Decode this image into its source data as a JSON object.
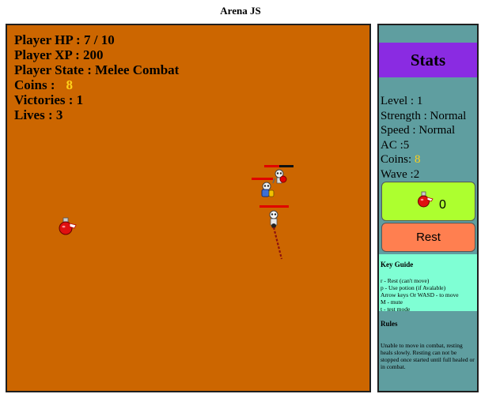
{
  "title": "Arena JS",
  "hud": {
    "hp": "Player HP : 7 / 10",
    "xp": "Player XP : 200",
    "state": "Player State : Melee Combat",
    "coins_label": "Coins :",
    "coins_value": "8",
    "victories": "Victories : 1",
    "lives": "Lives : 3"
  },
  "stats": {
    "title": "Stats",
    "level": "Level : 1",
    "strength": "Strength : Normal",
    "speed": "Speed : Normal",
    "ac": "AC :5",
    "coins_label": "Coins:",
    "coins_value": "8",
    "wave": "Wave :2"
  },
  "potion_button": {
    "count": "0",
    "icon": "red-potion-icon"
  },
  "rest_button": {
    "label": "Rest"
  },
  "key_guide": {
    "heading": "Key Guide",
    "lines": [
      "r - Rest (can't move)",
      "p - Use potion (if Avalable)",
      "Arrow keys Or WASD - to move",
      "M - mute",
      "t - test mode"
    ]
  },
  "rules": {
    "heading": "Rules",
    "text": "Unable to move in combat, resting heals slowly. Resting can not be stopped once started until full healed or in combat."
  },
  "colors": {
    "arena": "#cc6600",
    "panel": "#5f9ea0",
    "stats_header": "#8a2be2",
    "potion_button": "#adff2f",
    "rest_button": "#ff7f50",
    "key_guide": "#7fffd4",
    "coin": "#ffd11a"
  },
  "entities": {
    "enemy_1": {
      "icon": "skeleton-warrior-icon",
      "hp_fraction": 0.5
    },
    "enemy_2": {
      "icon": "skeleton-shield-icon",
      "hp_fraction": 1.0
    },
    "player": {
      "icon": "skeleton-player-icon",
      "hp_fraction": 1.0
    },
    "potion_pickup": {
      "icon": "red-potion-icon"
    }
  }
}
